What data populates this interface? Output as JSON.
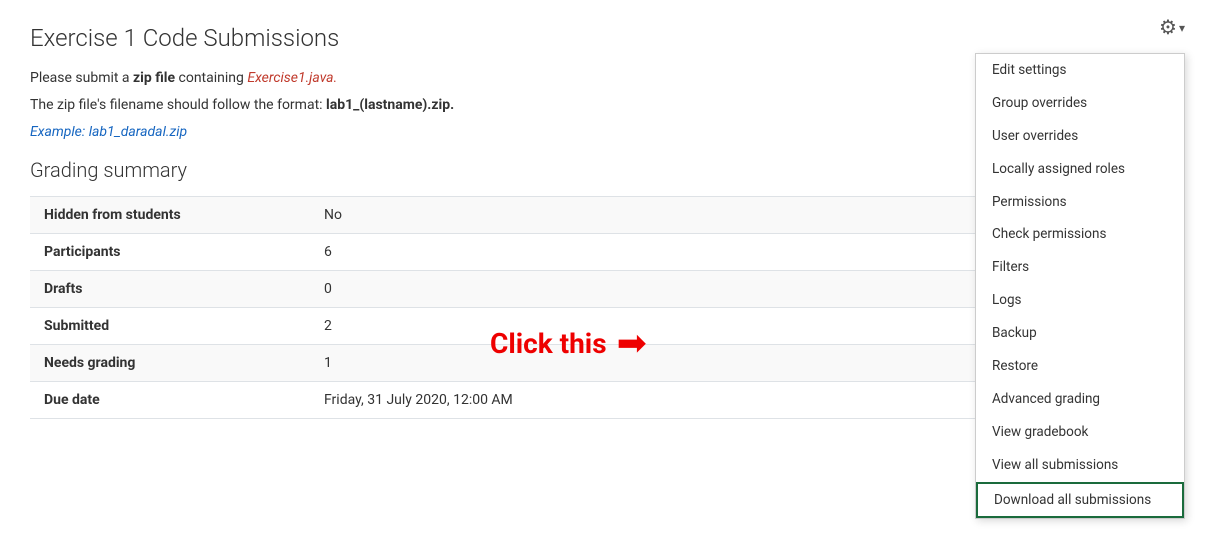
{
  "page": {
    "title": "Exercise 1 Code Submissions",
    "description1_prefix": "Please submit a ",
    "description1_bold": "zip file",
    "description1_suffix": " containing ",
    "description1_italic": "Exercise1.java.",
    "description2_prefix": "The zip file's filename should follow the format: ",
    "description2_bold": "lab1_(lastname).zip.",
    "example_prefix": "Example: ",
    "example_link": "lab1_daradal.zip"
  },
  "grading_summary": {
    "heading": "Grading summary",
    "rows": [
      {
        "label": "Hidden from students",
        "value": "No"
      },
      {
        "label": "Participants",
        "value": "6"
      },
      {
        "label": "Drafts",
        "value": "0"
      },
      {
        "label": "Submitted",
        "value": "2"
      },
      {
        "label": "Needs grading",
        "value": "1"
      },
      {
        "label": "Due date",
        "value": "Friday, 31 July 2020, 12:00 AM"
      }
    ]
  },
  "gear_menu": {
    "items": [
      {
        "label": "Edit settings"
      },
      {
        "label": "Group overrides"
      },
      {
        "label": "User overrides"
      },
      {
        "label": "Locally assigned roles"
      },
      {
        "label": "Permissions"
      },
      {
        "label": "Check permissions"
      },
      {
        "label": "Filters"
      },
      {
        "label": "Logs"
      },
      {
        "label": "Backup"
      },
      {
        "label": "Restore"
      },
      {
        "label": "Advanced grading"
      },
      {
        "label": "View gradebook"
      },
      {
        "label": "View all submissions"
      },
      {
        "label": "Download all submissions",
        "highlighted": true
      }
    ]
  },
  "click_annotation": {
    "text": "Click this"
  }
}
